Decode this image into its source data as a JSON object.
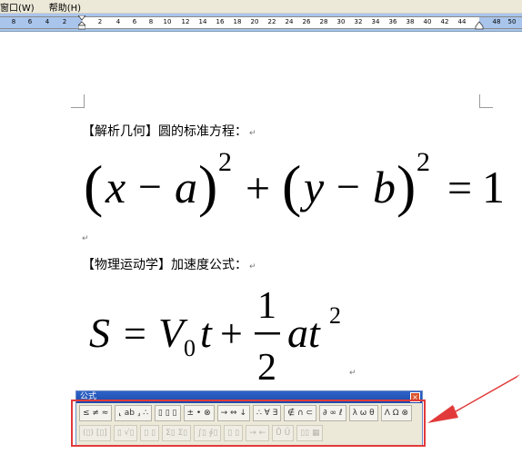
{
  "menubar": {
    "items": [
      "窗口(W)",
      "帮助(H)"
    ]
  },
  "ruler": {
    "ticks": [
      "8",
      "6",
      "4",
      "2",
      "2",
      "4",
      "6",
      "8",
      "10",
      "12",
      "14",
      "16",
      "18",
      "20",
      "22",
      "24",
      "26",
      "28",
      "30",
      "32",
      "34",
      "36",
      "38",
      "40",
      "42",
      "44",
      "48",
      "50"
    ]
  },
  "document": {
    "heading1": "【解析几何】圆的标准方程：",
    "heading2": "【物理运动学】加速度公式：",
    "return_mark": "↵",
    "eq1": {
      "lparen": "(",
      "x": "x",
      "minus": "−",
      "a": "a",
      "rparen": ")",
      "exp": "2",
      "plus": "+",
      "lparen2": "(",
      "y": "y",
      "minus2": "−",
      "b": "b",
      "rparen2": ")",
      "exp2": "2",
      "equals": "=",
      "one": "1"
    },
    "eq2": {
      "S": "S",
      "equals": "=",
      "V": "V",
      "sub0": "0",
      "t": "t",
      "plus": "+",
      "num": "1",
      "den": "2",
      "at": "at",
      "exp": "2"
    }
  },
  "equation_toolbar": {
    "title": "公式",
    "close": "×",
    "row1": [
      "≤ ≠ ≈",
      "⸤ ab ⸥ ∴",
      "▯ ▯ ▯",
      "± • ⊗",
      "→ ⇔ ↓",
      "∴ ∀ ∃",
      "∉ ∩ ⊂",
      "∂ ∞ ℓ",
      "λ ω θ",
      "Λ Ω ⊗"
    ],
    "row2": [
      "(▯) [▯]",
      "▯ √▯",
      "▯ ▯",
      "Σ▯ Σ▯",
      "∫▯ ∮▯",
      "▯ ▯",
      "→ ←",
      "Ů Ũ",
      "▯▯ ▦"
    ]
  },
  "colors": {
    "highlight": "#e23a3a",
    "titlebar": "#2e63c8",
    "ruler_bg": "#a9c5ec"
  }
}
